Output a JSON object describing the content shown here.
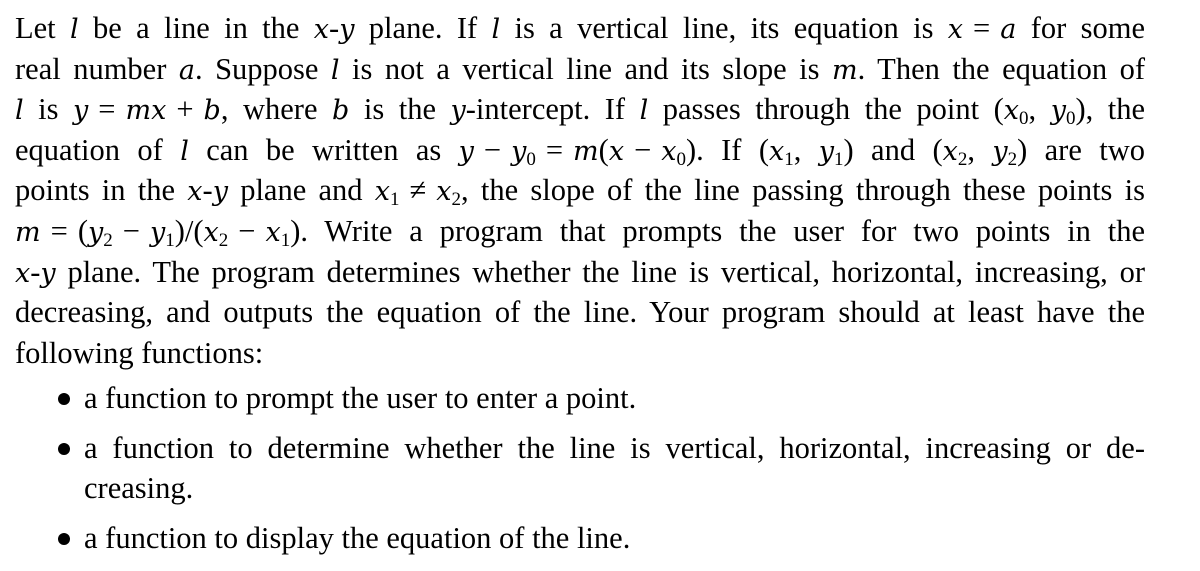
{
  "document": {
    "paragraph_lines": [
      {
        "segments": [
          {
            "t": "Let "
          },
          {
            "m": "l"
          },
          {
            "t": " be a line in the "
          },
          {
            "m": "x"
          },
          {
            "t": "-"
          },
          {
            "m": "y"
          },
          {
            "t": " plane.  If "
          },
          {
            "m": "l"
          },
          {
            "t": " is a vertical line, its equation is "
          },
          {
            "m": "x"
          },
          {
            "op": "="
          },
          {
            "m": "a"
          },
          {
            "t": " for some"
          }
        ]
      },
      {
        "segments": [
          {
            "t": "real number "
          },
          {
            "m": "a"
          },
          {
            "t": ".  Suppose "
          },
          {
            "m": "l"
          },
          {
            "t": " is not a vertical line and its slope is "
          },
          {
            "m": "m"
          },
          {
            "t": ".  Then the equation of"
          }
        ]
      },
      {
        "segments": [
          {
            "m": "l"
          },
          {
            "t": " is "
          },
          {
            "m": "y"
          },
          {
            "op": "="
          },
          {
            "m": "mx"
          },
          {
            "op": "+"
          },
          {
            "m": "b"
          },
          {
            "t": ", where "
          },
          {
            "m": "b"
          },
          {
            "t": " is the "
          },
          {
            "m": "y"
          },
          {
            "t": "-intercept.  If "
          },
          {
            "m": "l"
          },
          {
            "t": " passes through the point ("
          },
          {
            "m": "x",
            "sub": "0"
          },
          {
            "t": ", "
          },
          {
            "m": "y",
            "sub": "0"
          },
          {
            "t": "), the"
          }
        ]
      },
      {
        "segments": [
          {
            "t": "equation of "
          },
          {
            "m": "l"
          },
          {
            "t": " can be written as "
          },
          {
            "m": "y"
          },
          {
            "op": "−"
          },
          {
            "m": "y",
            "sub": "0"
          },
          {
            "op": "="
          },
          {
            "m": "m"
          },
          {
            "t": "("
          },
          {
            "m": "x"
          },
          {
            "op": "−"
          },
          {
            "m": "x",
            "sub": "0"
          },
          {
            "t": ").  If ("
          },
          {
            "m": "x",
            "sub": "1"
          },
          {
            "t": ", "
          },
          {
            "m": "y",
            "sub": "1"
          },
          {
            "t": ") and ("
          },
          {
            "m": "x",
            "sub": "2"
          },
          {
            "t": ", "
          },
          {
            "m": "y",
            "sub": "2"
          },
          {
            "t": ") are two"
          }
        ]
      },
      {
        "segments": [
          {
            "t": "points in the "
          },
          {
            "m": "x"
          },
          {
            "t": "-"
          },
          {
            "m": "y"
          },
          {
            "t": " plane and "
          },
          {
            "m": "x",
            "sub": "1"
          },
          {
            "op": "≠"
          },
          {
            "m": "x",
            "sub": "2"
          },
          {
            "t": ", the slope of the line passing through these points is"
          }
        ]
      },
      {
        "segments": [
          {
            "m": "m"
          },
          {
            "op": "="
          },
          {
            "t": "("
          },
          {
            "m": "y",
            "sub": "2"
          },
          {
            "op": "−"
          },
          {
            "m": "y",
            "sub": "1"
          },
          {
            "t": ")/("
          },
          {
            "m": "x",
            "sub": "2"
          },
          {
            "op": "−"
          },
          {
            "m": "x",
            "sub": "1"
          },
          {
            "t": ").  Write a program that prompts the user for two points in the"
          }
        ]
      },
      {
        "segments": [
          {
            "m": "x"
          },
          {
            "t": "-"
          },
          {
            "m": "y"
          },
          {
            "t": " plane. The program determines whether the line is vertical, horizontal, increasing, or"
          }
        ]
      },
      {
        "segments": [
          {
            "t": "decreasing, and outputs the equation of the line.  Your program should at least have the"
          }
        ]
      },
      {
        "segments": [
          {
            "t": "following functions:"
          }
        ],
        "last": true
      }
    ],
    "bullets": [
      {
        "lines": [
          "a function to prompt the user to enter a point."
        ]
      },
      {
        "lines": [
          "a function to determine whether the line is vertical, horizontal, increasing or de-",
          "creasing."
        ]
      },
      {
        "lines": [
          "a function to display the equation of the line."
        ]
      }
    ]
  }
}
